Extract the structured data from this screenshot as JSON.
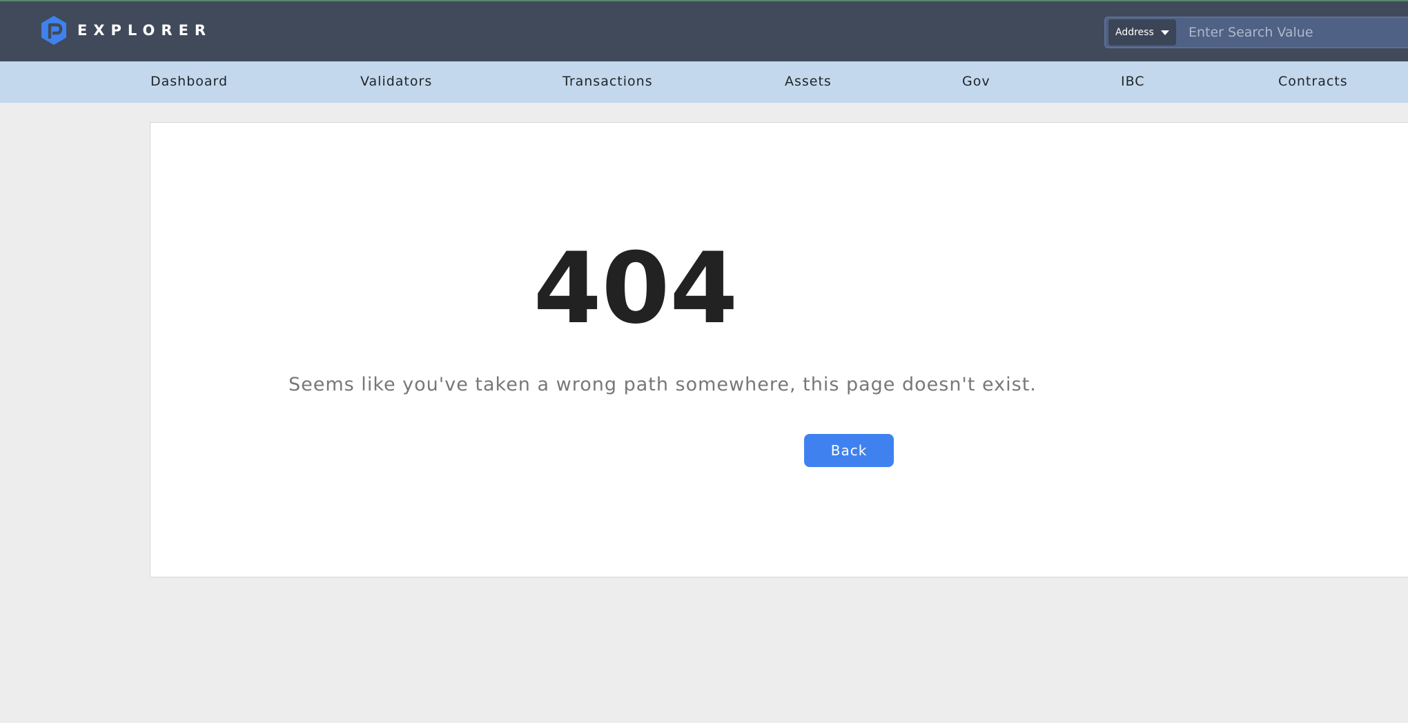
{
  "header": {
    "logo_text": "EXPLORER",
    "logo_icon": "hexagon-p-logo-icon",
    "search": {
      "type_label": "Address",
      "placeholder": "Enter Search Value"
    }
  },
  "nav": {
    "items": [
      {
        "label": "Dashboard"
      },
      {
        "label": "Validators"
      },
      {
        "label": "Transactions"
      },
      {
        "label": "Assets"
      },
      {
        "label": "Gov"
      },
      {
        "label": "IBC"
      },
      {
        "label": "Contracts"
      }
    ]
  },
  "error": {
    "code": "404",
    "message": "Seems like you've taken a wrong path somewhere, this page doesn't exist.",
    "back_label": "Back"
  },
  "colors": {
    "topbar": "#414a5a",
    "navbar": "#c3d8ec",
    "accent": "#3f82ef",
    "background": "#ededed"
  }
}
